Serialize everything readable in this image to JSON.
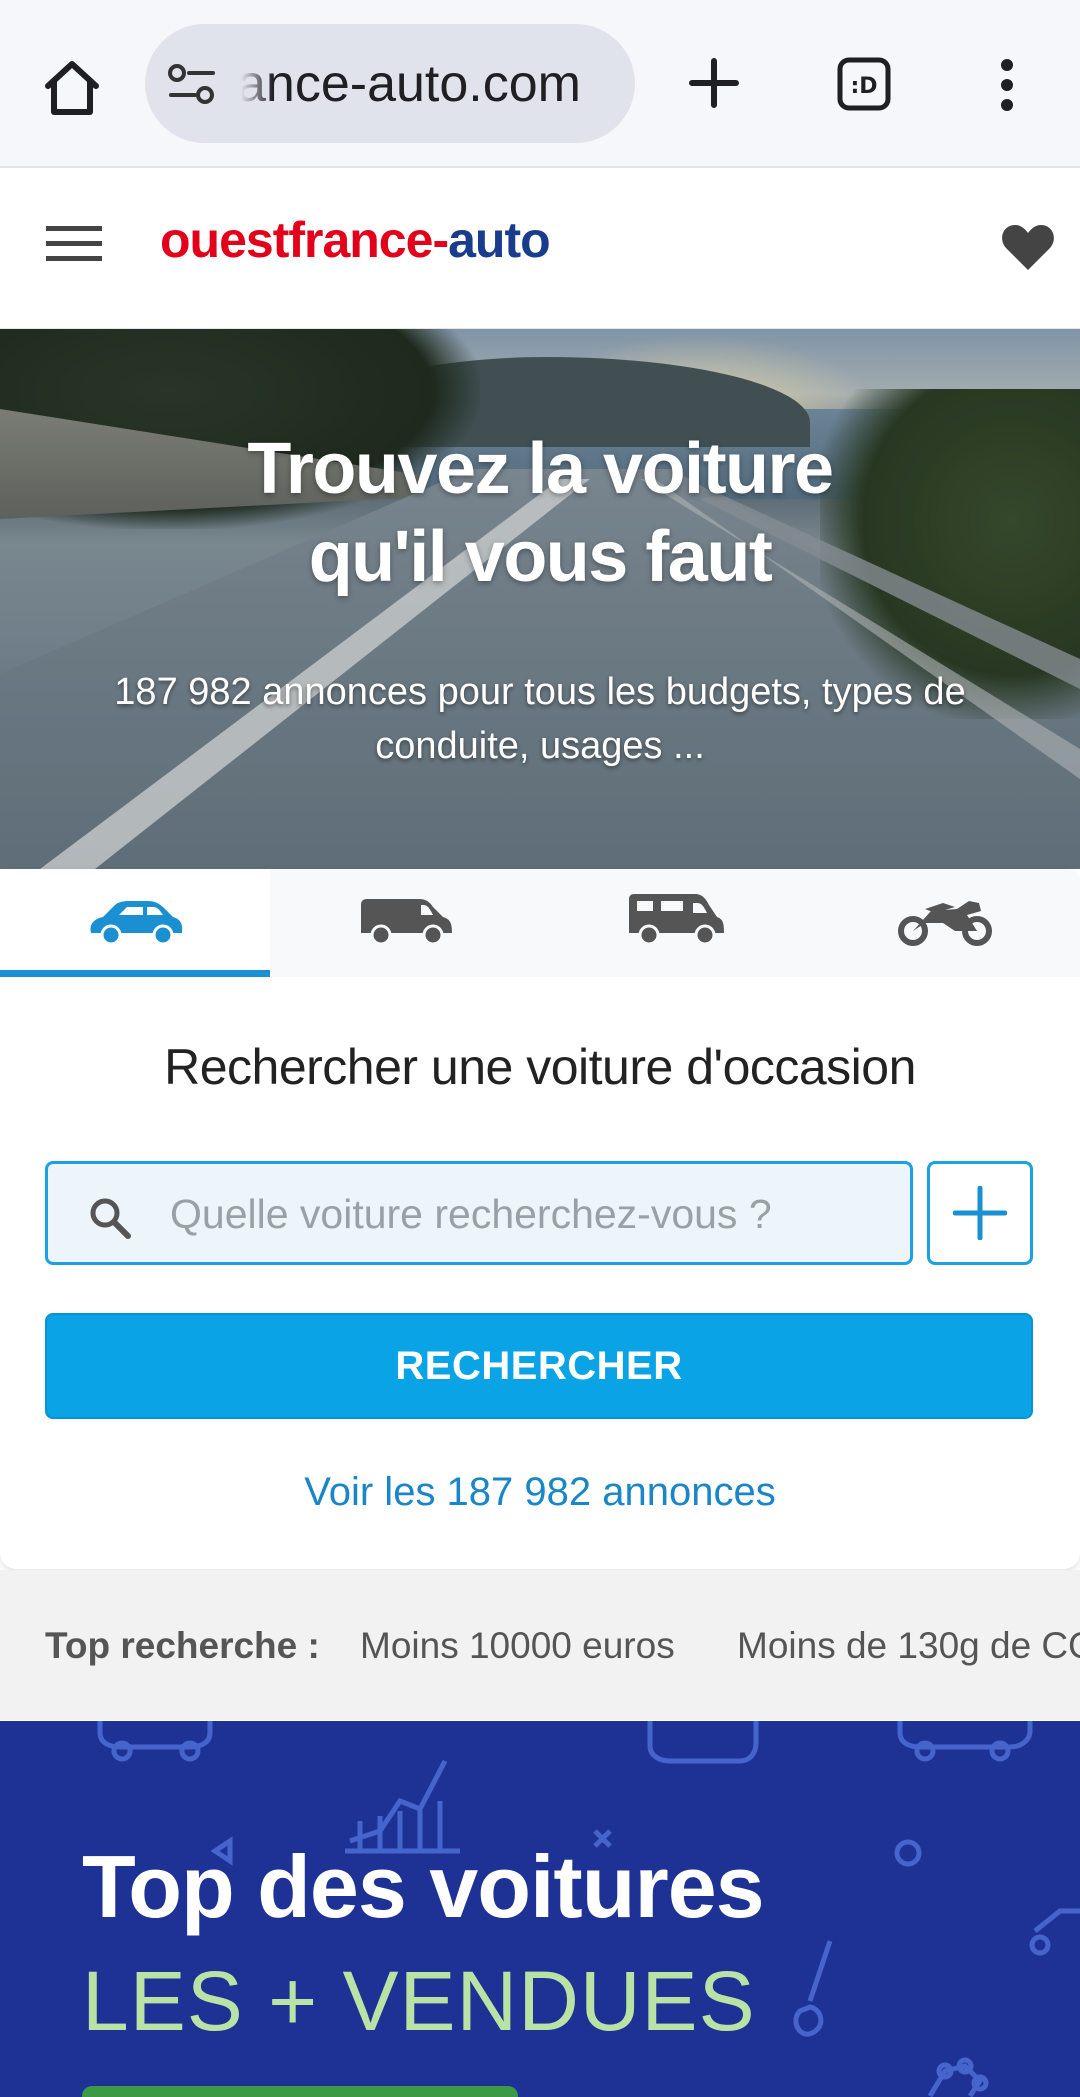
{
  "browser": {
    "url": "ance-auto.com"
  },
  "header": {
    "logo_part1": "ouestfrance",
    "logo_dash": "-",
    "logo_part2": "auto"
  },
  "hero": {
    "title_line1": "Trouvez la voiture",
    "title_line2": "qu'il vous faut",
    "subtitle": "187 982 annonces pour tous les budgets, types de conduite, usages ..."
  },
  "vehicle_tabs": [
    {
      "icon": "car-icon",
      "active": true
    },
    {
      "icon": "van-icon",
      "active": false
    },
    {
      "icon": "camper-van-icon",
      "active": false
    },
    {
      "icon": "motorcycle-icon",
      "active": false
    }
  ],
  "search": {
    "heading": "Rechercher une voiture d'occasion",
    "placeholder": "Quelle voiture recherchez-vous ?",
    "button_label": "RECHERCHER",
    "see_all_label": "Voir les 187 982 annonces"
  },
  "top_search": {
    "label": "Top recherche :",
    "chips": [
      "Moins 10000 euros",
      "Moins de 130g de CO"
    ]
  },
  "banner": {
    "line1": "Top des voitures",
    "line2": "LES + VENDUES"
  },
  "colors": {
    "accent": "#0aa3e6",
    "logo_red": "#e2001a",
    "logo_blue": "#1a3c8c",
    "banner_bg": "#1e3296",
    "link": "#1a86c8"
  }
}
